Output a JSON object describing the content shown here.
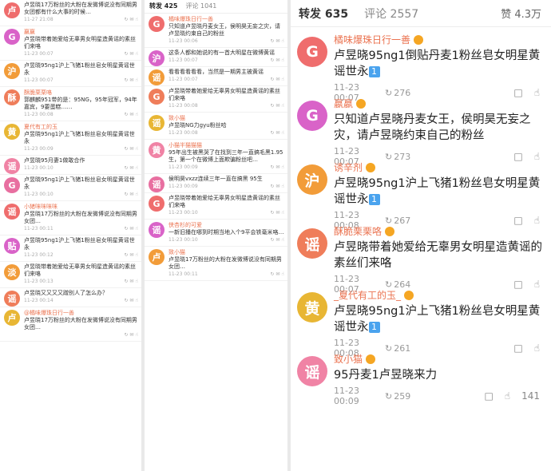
{
  "left_panel": {
    "comments": [
      {
        "avatar": "卢",
        "name": "",
        "text": "卢昱晓17万粉丝的大粉在发微博说没有同期男女团都有什么大事的时候…",
        "time": "11-27 21:08"
      },
      {
        "avatar": "G",
        "name": "嬴嬴",
        "text": "卢昱晓带着她爱给无辜男女明星造黄谣的素丝们来咯",
        "time": "11-23 00:07"
      },
      {
        "avatar": "沪",
        "name": "",
        "text": "卢昱晓95ng1沪上飞猪1粉丝皂女明星黄谣世永",
        "time": "11-23 00:07"
      },
      {
        "avatar": "酥",
        "name": "酥脆栗栗咯",
        "text": "郭麒麟951带的是：95NG，95年冠军，94年嘉宾，9要蛋糕……",
        "time": "11-23 00:08"
      },
      {
        "avatar": "黄",
        "name": "夏代有工的玉",
        "text": "卢昱晓95ng1沪上飞猪1粉丝皂女明星黄谣世永",
        "time": "11-23 00:09"
      },
      {
        "avatar": "谣",
        "name": "",
        "text": "卢昱晓95月妻1做敢合作",
        "time": "11-23 00:10"
      },
      {
        "avatar": "G",
        "name": "",
        "text": "卢昱晓95ng1沪上飞猪1粉丝皂女明星黄谣世永",
        "time": "11-23 00:10"
      },
      {
        "avatar": "谣",
        "name": "小猪咪咪咪咪",
        "text": "卢昱晓17万粉丝的大粉在发微博说没有同期男女团…",
        "time": "11-23 00:11"
      },
      {
        "avatar": "贴",
        "name": "",
        "text": "卢昱晓95ng1沪上飞猪1粉丝皂女明星黄谣世永",
        "time": "11-23 00:12"
      },
      {
        "avatar": "淡",
        "name": "",
        "text": "卢昱晓带着她爱给无辜男女明星造黄谣的素丝们来咯",
        "time": "11-23 00:13"
      },
      {
        "avatar": "谣",
        "name": "",
        "text": "卢昱晓又又又又蹭别人了怎么办？",
        "time": "11-23 00:14"
      },
      {
        "avatar": "卢",
        "name": "@橘味爆珠日行一善",
        "text": "卢昱晓17万粉丝的大粉在发微博说没有同期男女团…",
        "time": ""
      }
    ]
  },
  "middle_panel": {
    "tabs": {
      "repost": "转发 425",
      "comment": "评论 1041"
    },
    "comments": [
      {
        "avatar": "G",
        "name": "橘味爆珠日行一善",
        "text": "只知道卢昱晓丹麦女王，侯明昊无妄之灾，请卢昱晓约束自己的粉丝",
        "time": "11-23 00:06"
      },
      {
        "avatar": "沪",
        "name": "",
        "text": "这条人都和她说的有一首大明星在微博黄谣",
        "time": "11-23 00:07"
      },
      {
        "avatar": "谣",
        "name": "",
        "text": "看看看看看看，当然是一期男主被黄谣",
        "time": "11-23 00:07"
      },
      {
        "avatar": "G",
        "name": "",
        "text": "卢昱晓带着她爱给无辜男女明星造黄谣的素丝们来咯",
        "time": "11-23 00:08"
      },
      {
        "avatar": "谣",
        "name": "致小猫",
        "text": "卢昱晓NG力gyu粉丝哈",
        "time": "11-23 00:08"
      },
      {
        "avatar": "黄",
        "name": "小猫半猫猫猫",
        "text": "95年出生被黑哭了在找到三年一直搞毛黑1.95生，第一个在微博上面欺骗粉丝吧…",
        "time": "11-23 00:09"
      },
      {
        "avatar": "谣",
        "name": "",
        "text": "侯明昊vxzz连续三年一直在搞黑 95生",
        "time": "11-23 00:09"
      },
      {
        "avatar": "G",
        "name": "",
        "text": "卢昱晓带着她爱给无辜男女明星造黄谣的素丝们来咯",
        "time": "11-23 00:10"
      },
      {
        "avatar": "谣",
        "name": "侠杏杉的可爱",
        "text": "一新旧播在哪到时期当地入个9平会铁毫米咯…",
        "time": "11-23 00:10"
      },
      {
        "avatar": "卢",
        "name": "致小猫",
        "text": "卢昱晓17万粉丝的大粉在发微博说没有同期男女团…",
        "time": "11-23 00:11"
      }
    ]
  },
  "main_panel": {
    "tabs": {
      "repost": "转发 635",
      "comment": "评论 2557",
      "likes": "赞 4.3万"
    },
    "comments": [
      {
        "avatar": "G",
        "color": "c-a",
        "name": "橘味爆珠日行一善",
        "text": "卢昱晓95ng1倒贴丹麦1粉丝皂女明星黄谣世永",
        "num": "1",
        "time": "11-23 00:07",
        "reposts": "276"
      },
      {
        "avatar": "G",
        "color": "c-b",
        "name": "嬴嬴",
        "text": "只知道卢昱晓丹麦女王，侯明昊无妄之灾，请卢昱晓约束自己的粉丝",
        "num": "",
        "time": "11-23 00:07",
        "reposts": "273"
      },
      {
        "avatar": "沪",
        "color": "c-c",
        "name": "诱辛剂",
        "text": "卢昱晓95ng1沪上飞猪1粉丝皂女明星黄谣世永",
        "num": "1",
        "time": "11-23 00:08",
        "reposts": "267"
      },
      {
        "avatar": "谣",
        "color": "c-d",
        "name": "酥脆栗栗咯",
        "text": "卢昱晓带着她爱给无辜男女明星造黄谣的素丝们来咯",
        "num": "",
        "time": "11-23 00:07",
        "reposts": "264"
      },
      {
        "avatar": "黄",
        "color": "c-e",
        "name": "_夏代有工的玉_",
        "text": "卢昱晓95ng1沪上飞猪1粉丝皂女明星黄谣世永",
        "num": "1",
        "time": "11-23 00:08",
        "reposts": "261"
      },
      {
        "avatar": "谣",
        "color": "c-f",
        "name": "致小猫",
        "text": "95丹麦1卢昱晓来力",
        "num": "",
        "time": "11-23 00:09",
        "reposts": "259",
        "likes": "141"
      }
    ]
  },
  "icons": {
    "repost": "repost-icon",
    "comment": "comment-icon",
    "like": "like-icon"
  }
}
